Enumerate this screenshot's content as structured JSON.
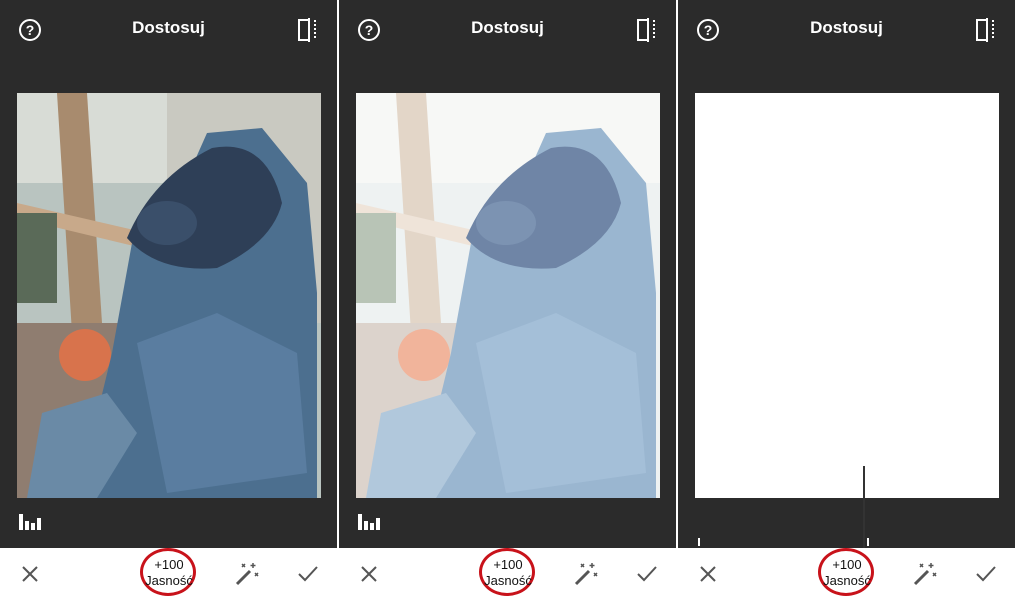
{
  "panels": [
    {
      "title": "Dostosuj",
      "adjust_value": "+100",
      "adjust_label": "Jasność",
      "photo_state": "normal"
    },
    {
      "title": "Dostosuj",
      "adjust_value": "+100",
      "adjust_label": "Jasność",
      "photo_state": "brightened"
    },
    {
      "title": "Dostosuj",
      "adjust_value": "+100",
      "adjust_label": "Jasność",
      "photo_state": "fully-white"
    }
  ],
  "icons": {
    "help": "help-icon",
    "compare": "compare-icon",
    "histogram": "histogram-icon",
    "close": "close-icon",
    "auto": "magic-wand-icon",
    "confirm": "checkmark-icon"
  },
  "colors": {
    "toolbar_bg": "#2b2b2b",
    "bottom_bar_bg": "#ffffff",
    "highlight_ring": "#c8121a"
  }
}
